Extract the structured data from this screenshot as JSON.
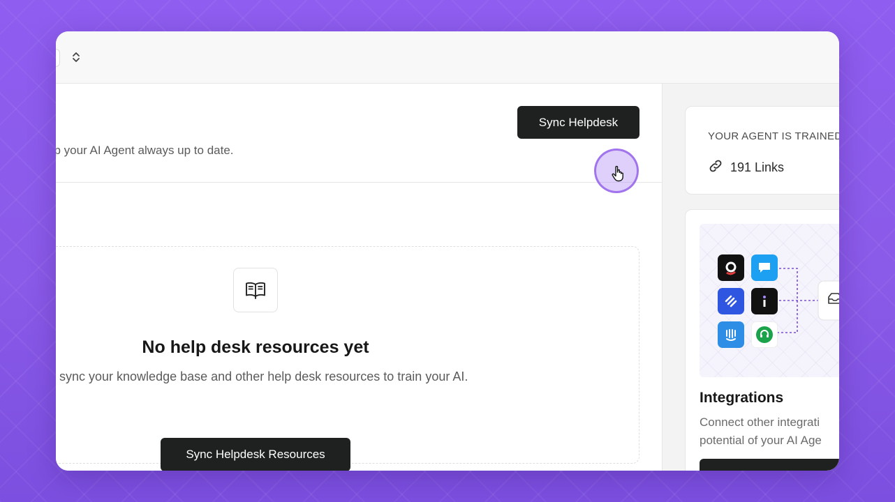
{
  "header": {
    "subtitle": "ep your AI Agent always up to date.",
    "sync_button_label": "Sync Helpdesk"
  },
  "empty_state": {
    "icon": "open-book-icon",
    "title": "No help desk resources yet",
    "description": "d sync your knowledge base and other help desk resources to train your AI.",
    "button_label": "Sync Helpdesk Resources"
  },
  "sidebar": {
    "trained": {
      "heading": "YOUR AGENT IS TRAINED",
      "links_label": "191 Links",
      "icon": "link-icon"
    },
    "integrations": {
      "title": "Integrations",
      "description": "Connect other integrati potential of your AI Age"
    }
  },
  "colors": {
    "background": "#8b5cf0",
    "dark_button": "#1f2121",
    "cursor_highlight": "#a078f0"
  }
}
